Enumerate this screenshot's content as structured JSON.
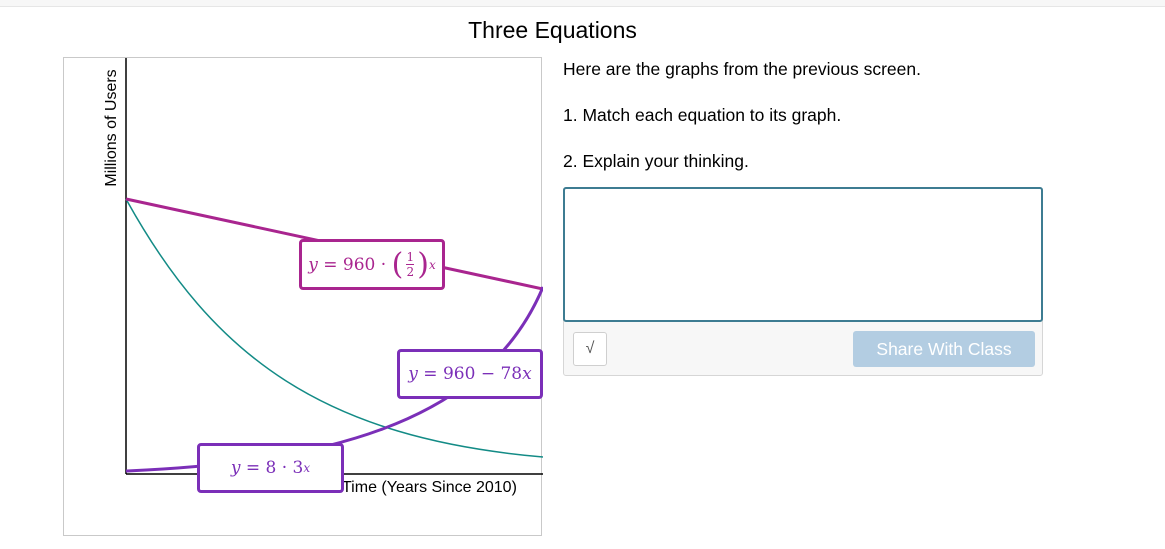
{
  "page": {
    "title": "Three Equations"
  },
  "graph": {
    "ylabel": "Millions of Users",
    "xlabel": "Time (Years Since 2010)",
    "colors": {
      "magenta": "#a9258f",
      "purple": "#7b2fb8",
      "teal": "#138b86"
    },
    "equations": {
      "eq1": {
        "lhs": "y",
        "coef": "960",
        "frac_num": "1",
        "frac_den": "2",
        "exp": "x"
      },
      "eq2": {
        "text": "960 − 78",
        "var": "x",
        "lhs": "y"
      },
      "eq3": {
        "lhs": "y",
        "rhs": "8 · 3",
        "exp": "x"
      }
    }
  },
  "instructions": {
    "line1": "Here are the graphs from the previous screen.",
    "line2": "1. Match each equation to its graph.",
    "line3": "2. Explain your thinking."
  },
  "response": {
    "placeholder": "",
    "math_icon": "√",
    "share_label": "Share With Class"
  }
}
